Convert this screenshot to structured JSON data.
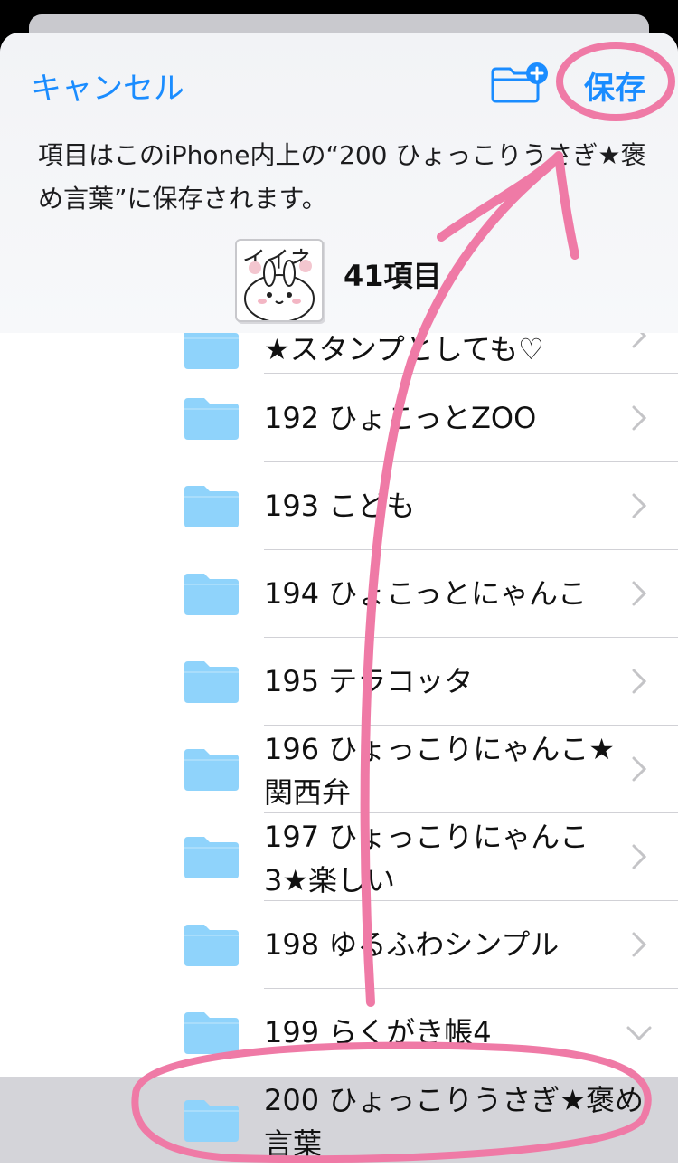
{
  "header": {
    "cancel_label": "キャンセル",
    "save_label": "保存",
    "description": "項目はこのiPhone内上の“200 ひょっこりうさぎ★褒め言葉”に保存されます。",
    "item_count": "41項目",
    "thumb_text": "イイネ"
  },
  "folders": [
    {
      "label": "★スタンプとしても♡"
    },
    {
      "label": "192 ひょこっとZOO"
    },
    {
      "label": "193 こども"
    },
    {
      "label": "194 ひょこっとにゃんこ"
    },
    {
      "label": "195 テラコッタ"
    },
    {
      "label": "196 ひょっこりにゃんこ★関西弁"
    },
    {
      "label": "197 ひょっこりにゃんこ3★楽しい"
    },
    {
      "label": "198 ゆるふわシンプル"
    },
    {
      "label": "199 らくがき帳4"
    },
    {
      "label": "200 ひょっこりうさぎ★褒め言葉"
    }
  ],
  "colors": {
    "accent": "#1a8cff",
    "folder": "#8fd3fb",
    "annotation": "#ef7aa6"
  },
  "icons": {
    "new_folder": "folder-plus-icon",
    "chevron_right": "chevron-right-icon",
    "chevron_down": "chevron-down-icon"
  }
}
